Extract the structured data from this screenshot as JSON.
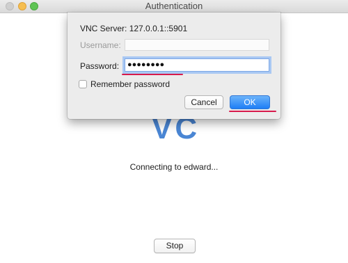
{
  "window": {
    "title": "Authentication"
  },
  "background": {
    "watermark": "VC",
    "status_text": "Connecting to edward...",
    "stop_label": "Stop"
  },
  "dialog": {
    "server_label": "VNC Server:",
    "server_address": "127.0.0.1::5901",
    "username_label": "Username:",
    "username_value": "",
    "password_label": "Password:",
    "password_value": "●●●●●●●●",
    "remember_label": "Remember password",
    "remember_checked": false,
    "cancel_label": "Cancel",
    "ok_label": "OK"
  },
  "colors": {
    "accent": "#1d7ef6",
    "annotation_underline": "#d71a4c",
    "focus_ring": "#a9c8f3"
  }
}
